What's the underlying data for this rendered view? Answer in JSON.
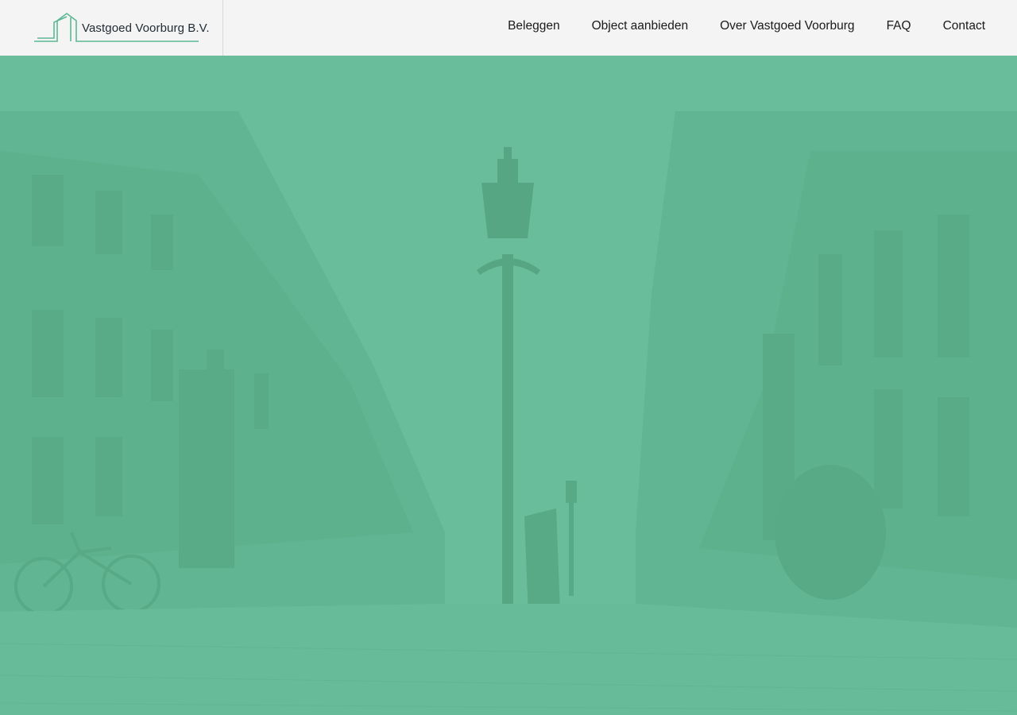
{
  "brand": {
    "name": "Vastgoed Voorburg B.V.",
    "accent_color": "#5cb894",
    "logo_icon": "house-outline-icon"
  },
  "nav": {
    "items": [
      {
        "label": "Beleggen"
      },
      {
        "label": "Object aanbieden"
      },
      {
        "label": "Over Vastgoed Voorburg"
      },
      {
        "label": "FAQ"
      },
      {
        "label": "Contact"
      }
    ]
  },
  "hero": {
    "tint_color": "#69bd9a",
    "image": "street-with-lamppost"
  }
}
